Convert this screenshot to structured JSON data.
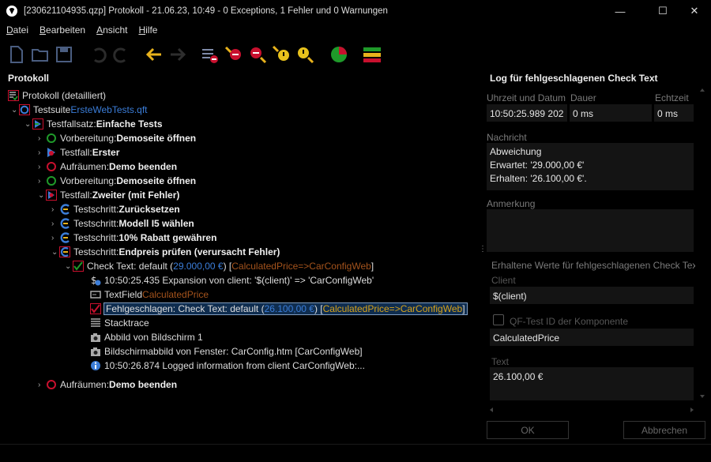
{
  "window": {
    "title": "[230621104935.qzp] Protokoll - 21.06.23, 10:49 - 0 Exceptions, 1 Fehler und 0 Warnungen",
    "controls": {
      "minimize": "—",
      "maximize": "☐",
      "close": "✕"
    }
  },
  "menu": [
    "Datei",
    "Bearbeiten",
    "Ansicht",
    "Hilfe"
  ],
  "left_panel": {
    "title": "Protokoll"
  },
  "tree": [
    {
      "prefix": "Protokoll (detailliert)",
      "bold": "",
      "suffix": ""
    },
    {
      "prefix": "Testsuite ",
      "bold": "",
      "link": "ErsteWebTests.qft"
    },
    {
      "prefix": "Testfallsatz: ",
      "bold": "Einfache Tests"
    },
    {
      "prefix": "Vorbereitung: ",
      "bold": "Demoseite öffnen"
    },
    {
      "prefix": "Testfall: ",
      "bold": "Erster"
    },
    {
      "prefix": "Aufräumen: ",
      "bold": "Demo beenden"
    },
    {
      "prefix": "Vorbereitung: ",
      "bold": "Demoseite öffnen"
    },
    {
      "prefix": "Testfall: ",
      "bold": "Zweiter (mit Fehler)"
    },
    {
      "prefix": "Testschritt: ",
      "bold": "Zurücksetzen"
    },
    {
      "prefix": "Testschritt: ",
      "bold": "Modell I5 wählen"
    },
    {
      "prefix": "Testschritt: ",
      "bold": "10% Rabatt gewähren"
    },
    {
      "prefix": "Testschritt: ",
      "bold": "Endpreis prüfen (verursacht Fehler)"
    },
    {
      "prefix": "Check Text: default (",
      "value": "29.000,00 €",
      "mid": ") [",
      "component": "CalculatedPrice=>CarConfigWeb",
      "end": "]"
    },
    {
      "prefix": "10:50:25.435 Expansion von client: '$(client)' => 'CarConfigWeb'"
    },
    {
      "prefix": "TextField ",
      "component": "CalculatedPrice"
    },
    {
      "prefix": "Fehlgeschlagen: Check Text: default (",
      "value": "26.100,00 €",
      "mid": ") [",
      "component": "CalculatedPrice=>CarConfigWeb",
      "end": "]"
    },
    {
      "prefix": "Stacktrace"
    },
    {
      "prefix": "Abbild von Bildschirm 1"
    },
    {
      "prefix": "Bildschirmabbild von Fenster: CarConfig.htm [CarConfigWeb]"
    },
    {
      "prefix": "10:50:26.874 Logged information from client CarConfigWeb:..."
    },
    {
      "prefix": "Aufräumen: ",
      "bold": "Demo beenden"
    }
  ],
  "right_panel": {
    "title": "Log für fehlgeschlagenen Check Text",
    "col_time": "Uhrzeit und Datum",
    "col_duration": "Dauer",
    "col_realtime": "Echtzeit",
    "time_value": "10:50:25.989  202",
    "duration_value": "0 ms",
    "realtime_value": "0 ms",
    "message_label": "Nachricht",
    "message": "Abweichung\nErwartet: '29.000,00 €'\nErhalten: '26.100,00 €'.",
    "comment_label": "Anmerkung",
    "received_section": "Erhaltene Werte für fehlgeschlagenen Check Tex",
    "client_label": "Client",
    "client_value": "$(client)",
    "component_label": "QF-Test ID der Komponente",
    "component_value": "CalculatedPrice",
    "text_label": "Text",
    "text_value": "26.100,00 €",
    "ok_button": "OK",
    "cancel_button": "Abbrechen"
  },
  "colors": {
    "link": "#3b7dd8",
    "component": "#a4531c",
    "selection": "#0f2d4f",
    "yellow_arrow": "#e8b21c"
  }
}
